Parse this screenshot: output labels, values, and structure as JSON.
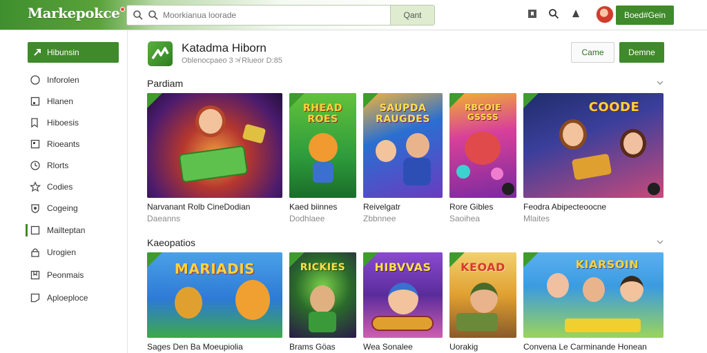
{
  "header": {
    "logo": "Markepokce",
    "search_placeholder": "Moorkianua loorade",
    "search_button": "Qant",
    "account_button": "Boed#Gein",
    "icons": [
      "bookmark-icon",
      "search-icon",
      "bell-icon",
      "avatar"
    ]
  },
  "sidebar": {
    "active": "Hibunsin",
    "items": [
      {
        "label": "Inforolen",
        "icon": "circle-icon"
      },
      {
        "label": "Hlanen",
        "icon": "square-icon"
      },
      {
        "label": "Hiboesis",
        "icon": "bookmark-icon"
      },
      {
        "label": "Rioeants",
        "icon": "square-icon"
      },
      {
        "label": "Rlorts",
        "icon": "clock-icon"
      },
      {
        "label": "Codies",
        "icon": "star-icon"
      },
      {
        "label": "Cogeing",
        "icon": "shield-icon"
      },
      {
        "label": "Mailteptan",
        "icon": "square-icon"
      },
      {
        "label": "Urogien",
        "icon": "lock-icon"
      },
      {
        "label": "Peonmais",
        "icon": "bookmark-icon"
      },
      {
        "label": "Aploeploce",
        "icon": "square-icon"
      }
    ]
  },
  "app": {
    "title": "Katadma Hiborn",
    "subtitle": "Oblenocpaeo 3 ≯ Rlueor D:85",
    "secondary_button": "Came",
    "primary_button": "Demne"
  },
  "sections": [
    {
      "title": "Pardiam",
      "cards": [
        {
          "title": "Narvanant Rolb CineDodian",
          "sub": "Daeanns",
          "art": "",
          "palette": [
            "#6b2b8a",
            "#e0662a"
          ]
        },
        {
          "title": "Kaed biinnes",
          "sub": "Dodhlaee",
          "art": "RHEAD ROES",
          "palette": [
            "#2e9c3c",
            "#8fd14b"
          ]
        },
        {
          "title": "Reivelgatr",
          "sub": "Zbbnnee",
          "art": "SAUPDA RAUGDES",
          "palette": [
            "#2a6fd1",
            "#a344c9"
          ]
        },
        {
          "title": "Rore Gibles",
          "sub": "Saoihea",
          "art": "RBCOIE GSSSS",
          "palette": [
            "#c8338e",
            "#f0a030"
          ]
        },
        {
          "title": "Feodra Abipecteoocne",
          "sub": "Mlaites",
          "art": "COODE",
          "palette": [
            "#2c3f8f",
            "#d84a7c"
          ]
        }
      ]
    },
    {
      "title": "Kaeopatios",
      "cards": [
        {
          "title": "Sages Den Ba Moeupiolia",
          "sub": "",
          "art": "MARIADIS",
          "palette": [
            "#2d7ad6",
            "#5fb0e8"
          ]
        },
        {
          "title": "Brams Göas",
          "sub": "",
          "art": "RICKIES",
          "palette": [
            "#1d5c2a",
            "#7a2d9b"
          ]
        },
        {
          "title": "Wea Sonalee",
          "sub": "",
          "art": "HIBVVAS",
          "palette": [
            "#5a2c9b",
            "#e05fb0"
          ]
        },
        {
          "title": "Uorakig",
          "sub": "",
          "art": "KEOAD",
          "palette": [
            "#e0a030",
            "#8a5a2a"
          ]
        },
        {
          "title": "Convena Le Carminande Honean",
          "sub": "",
          "art": "KIARSOIN",
          "palette": [
            "#3b9be0",
            "#9bd45a"
          ]
        }
      ]
    }
  ]
}
